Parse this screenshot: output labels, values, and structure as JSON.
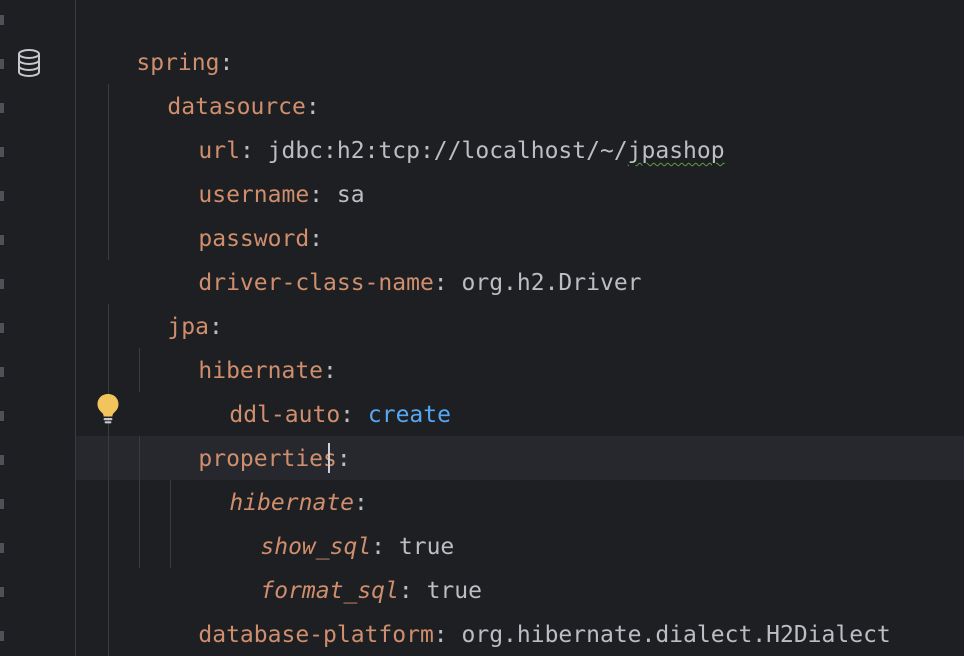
{
  "editor": {
    "lines": [
      {
        "key": "spring",
        "sep": ":",
        "value": ""
      },
      {
        "key": "datasource",
        "sep": ":",
        "value": ""
      },
      {
        "key": "url",
        "sep": ": ",
        "value": "jdbc:h2:tcp://localhost/~/",
        "value_squiggle": "jpashop"
      },
      {
        "key": "username",
        "sep": ": ",
        "value": "sa"
      },
      {
        "key": "password",
        "sep": ":",
        "value": ""
      },
      {
        "key": "driver-class-name",
        "sep": ": ",
        "value": "org.h2.Driver"
      },
      {
        "key": "jpa",
        "sep": ":",
        "value": ""
      },
      {
        "key": "hibernate",
        "sep": ":",
        "value": ""
      },
      {
        "key": "ddl-auto",
        "sep": ": ",
        "value": "create"
      },
      {
        "key": "properties",
        "sep": ":",
        "value": ""
      },
      {
        "key": "hibernate",
        "sep": ":",
        "value": ""
      },
      {
        "key": "show_sql",
        "sep": ": ",
        "value": "true"
      },
      {
        "key": "format_sql",
        "sep": ": ",
        "value": "true"
      },
      {
        "key": "database-platform",
        "sep": ": ",
        "value": "org.hibernate.dialect.H2Dialect"
      }
    ]
  },
  "gutter_icons": {
    "line2": "database-icon",
    "line10": "lightbulb-icon"
  },
  "colors": {
    "background": "#1e1f22",
    "current_line": "#26282e",
    "key": "#cf8e6d",
    "text": "#bcbec4",
    "enum_value": "#56a8f5",
    "bulb": "#f2c55c"
  }
}
